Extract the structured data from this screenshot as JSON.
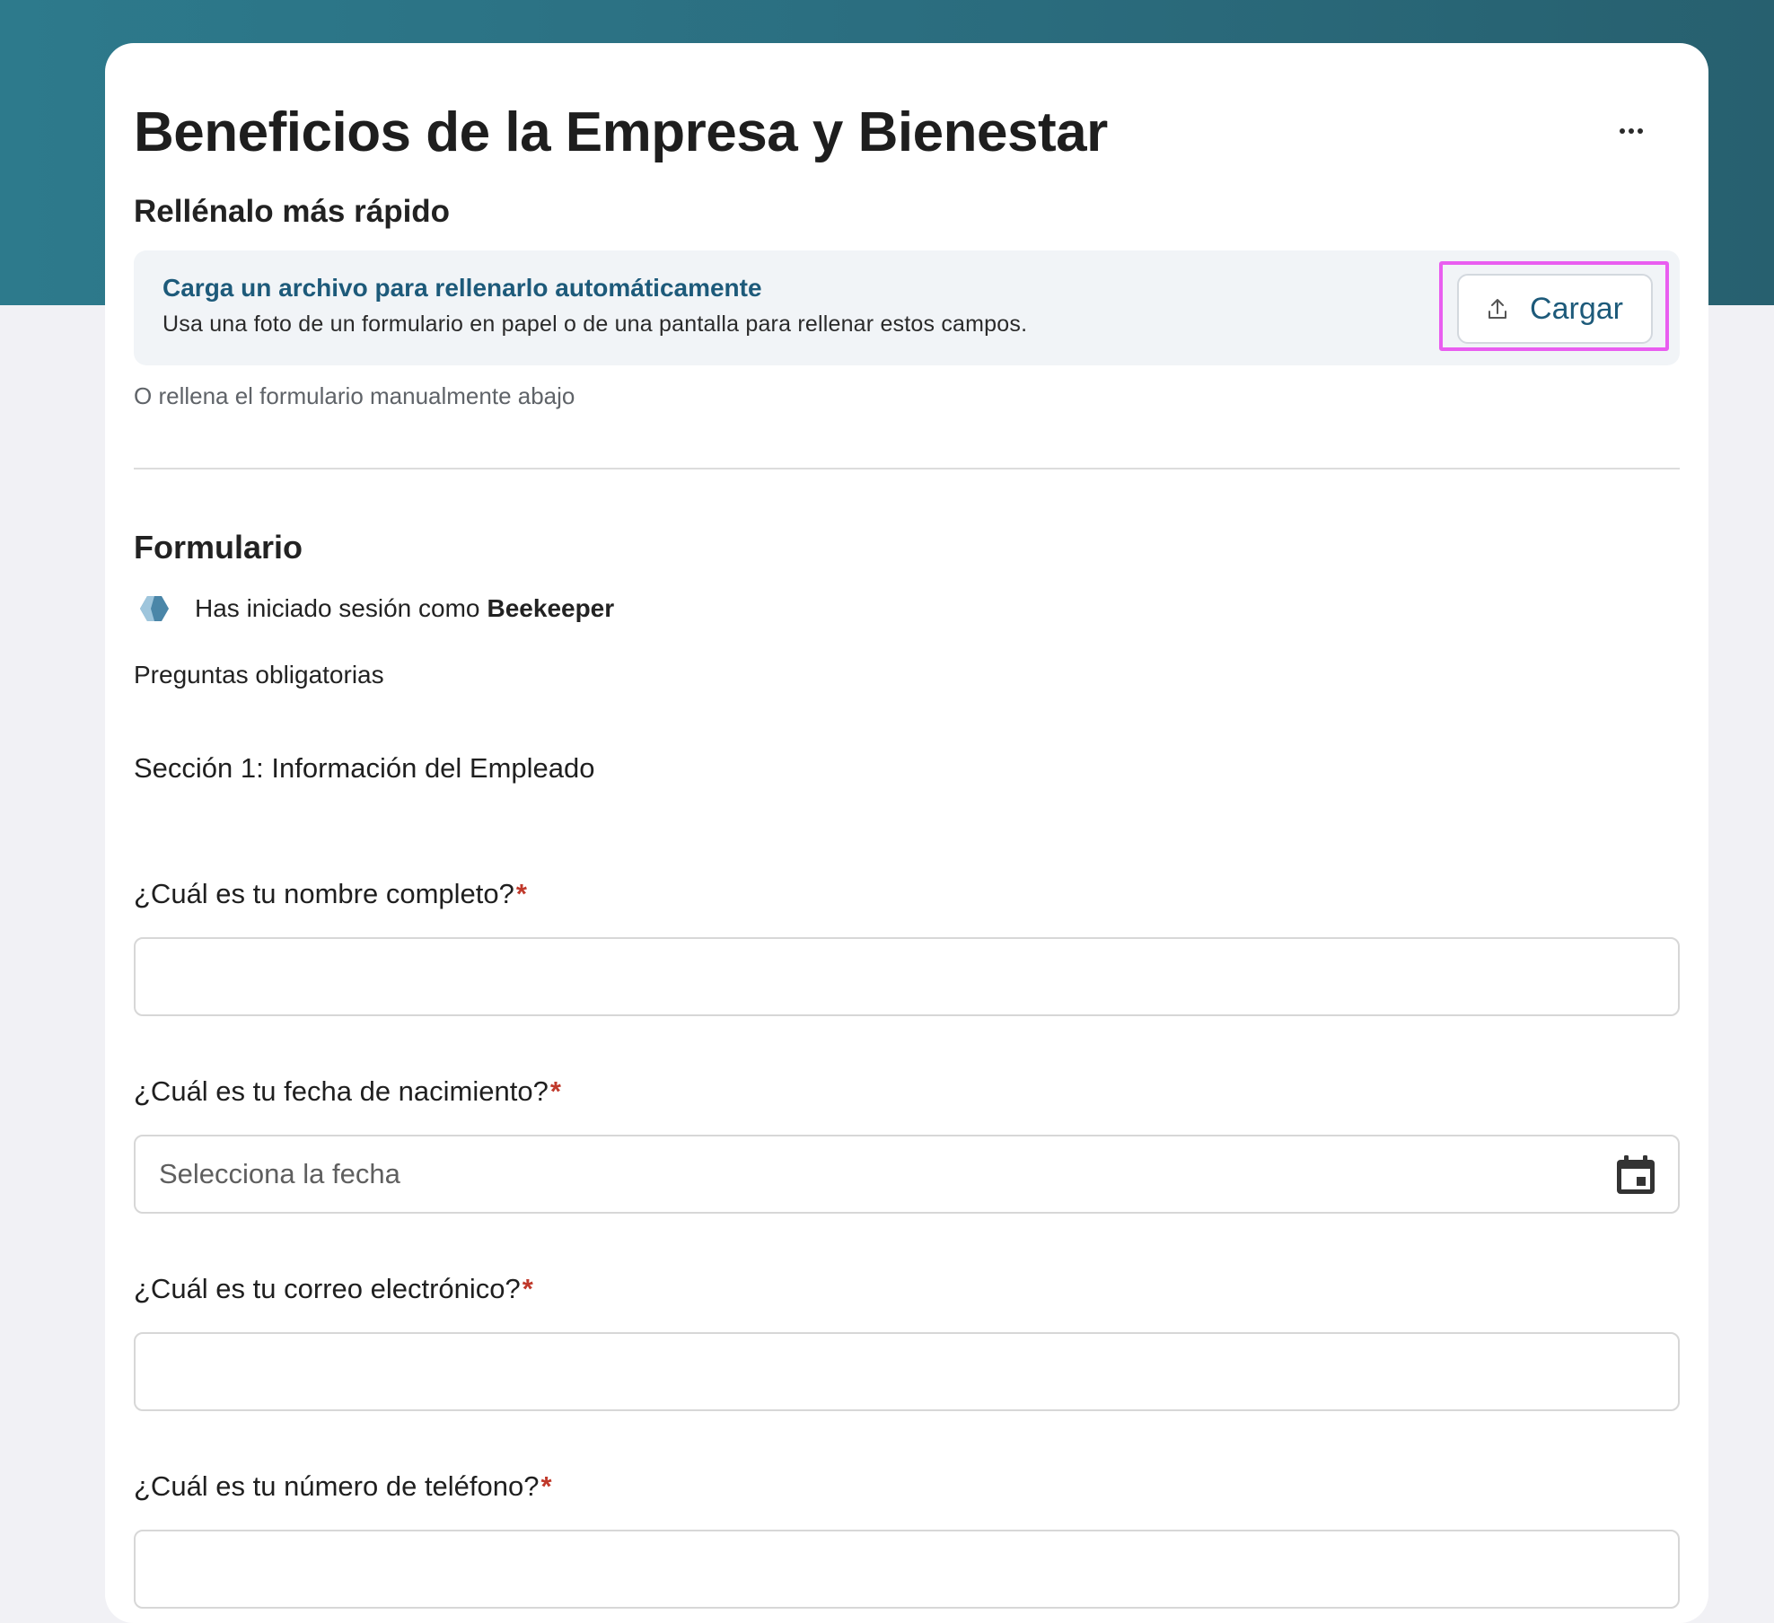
{
  "form": {
    "title": "Beneficios de la Empresa y Bienestar",
    "faster_heading": "Rellénalo más rápido",
    "upload": {
      "title": "Carga un archivo para rellenarlo automáticamente",
      "description": "Usa una foto de un formulario en papel o de una pantalla para rellenar estos campos.",
      "button_label": "Cargar"
    },
    "manual_note": "O rellena el formulario manualmente abajo",
    "section_heading": "Formulario",
    "signed_in": {
      "prefix": "Has iniciado sesión como",
      "user": "Beekeeper"
    },
    "required_note": "Preguntas obligatorias",
    "section_title": "Sección 1: Información del Empleado",
    "questions": [
      {
        "label": "¿Cuál es tu nombre completo?",
        "required_mark": "*",
        "value": "",
        "placeholder": ""
      },
      {
        "label": "¿Cuál es tu fecha de nacimiento?",
        "required_mark": "*",
        "value": "",
        "placeholder": "Selecciona la fecha"
      },
      {
        "label": "¿Cuál es tu correo electrónico?",
        "required_mark": "*",
        "value": "",
        "placeholder": ""
      },
      {
        "label": "¿Cuál es tu número de teléfono?",
        "required_mark": "*",
        "value": "",
        "placeholder": ""
      }
    ]
  },
  "icons": {
    "more": "more-horizontal-icon",
    "upload": "upload-icon",
    "brand": "beekeeper-logo-icon",
    "calendar": "calendar-icon"
  },
  "colors": {
    "header_band": "#2b6e80",
    "accent": "#1d5a7a",
    "highlight": "#e95ef0",
    "required": "#c0392b"
  }
}
